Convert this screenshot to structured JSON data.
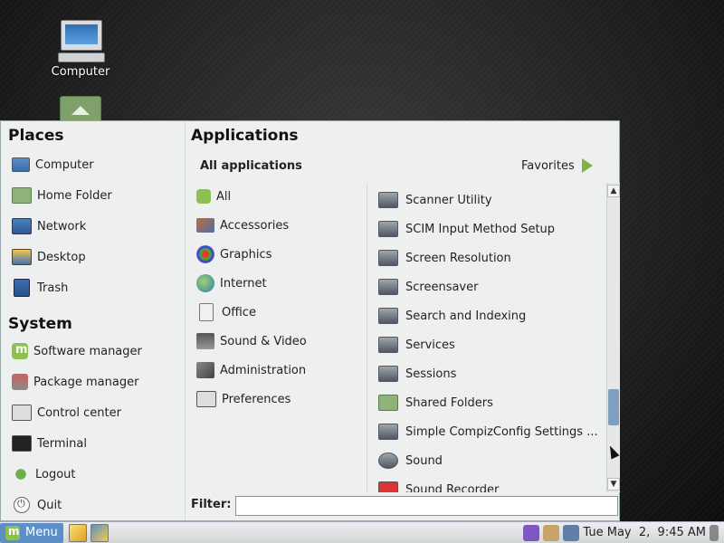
{
  "desktop": {
    "icons": [
      {
        "label": "Computer"
      }
    ]
  },
  "menu": {
    "places": {
      "title": "Places",
      "items": [
        {
          "label": "Computer",
          "icon": "computer-icon"
        },
        {
          "label": "Home Folder",
          "icon": "home-folder-icon"
        },
        {
          "label": "Network",
          "icon": "network-icon"
        },
        {
          "label": "Desktop",
          "icon": "desktop-icon"
        },
        {
          "label": "Trash",
          "icon": "trash-icon"
        }
      ]
    },
    "system": {
      "title": "System",
      "items": [
        {
          "label": "Software manager",
          "icon": "software-manager-icon"
        },
        {
          "label": "Package manager",
          "icon": "package-manager-icon"
        },
        {
          "label": "Control center",
          "icon": "control-center-icon"
        },
        {
          "label": "Terminal",
          "icon": "terminal-icon"
        },
        {
          "label": "Logout",
          "icon": "logout-icon"
        },
        {
          "label": "Quit",
          "icon": "power-icon"
        }
      ]
    },
    "applications": {
      "title": "Applications",
      "all_label": "All applications",
      "favorites_label": "Favorites",
      "categories": [
        {
          "label": "All"
        },
        {
          "label": "Accessories"
        },
        {
          "label": "Graphics"
        },
        {
          "label": "Internet"
        },
        {
          "label": "Office"
        },
        {
          "label": "Sound & Video"
        },
        {
          "label": "Administration"
        },
        {
          "label": "Preferences"
        }
      ],
      "apps": [
        {
          "label": "Scanner Utility"
        },
        {
          "label": "SCIM Input Method Setup"
        },
        {
          "label": "Screen Resolution"
        },
        {
          "label": "Screensaver"
        },
        {
          "label": "Search and Indexing"
        },
        {
          "label": "Services"
        },
        {
          "label": "Sessions"
        },
        {
          "label": "Shared Folders"
        },
        {
          "label": "Simple CompizConfig Settings ..."
        },
        {
          "label": "Sound"
        },
        {
          "label": "Sound Recorder"
        }
      ]
    },
    "filter": {
      "label": "Filter:",
      "value": ""
    },
    "scroll_position": 0.72
  },
  "panel": {
    "menu_label": "Menu",
    "clock": "Tue May  2,  9:45 AM"
  },
  "colors": {
    "accent": "#5b8fc6",
    "mint_green": "#8cc152"
  }
}
